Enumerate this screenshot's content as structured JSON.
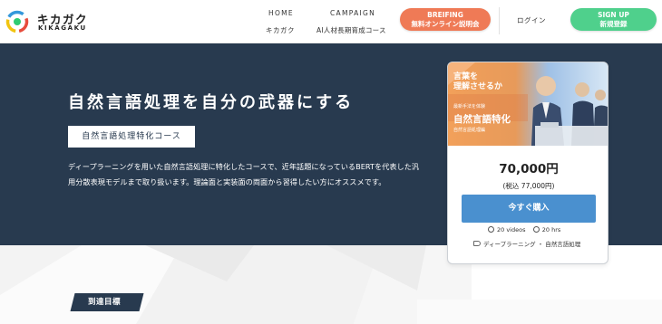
{
  "brand": {
    "name_jp": "キカガク",
    "name_en": "KIKAGAKU"
  },
  "nav": {
    "home": "HOME",
    "campaign": "CAMPAIGN",
    "kikagaku": "キカガク",
    "ai_course": "AI人材長期育成コース",
    "briefing_title": "BREIFING",
    "briefing_sub": "無料オンライン説明会",
    "login": "ログイン",
    "signup_title": "SIGN UP",
    "signup_sub": "新規登録"
  },
  "hero": {
    "title": "自然言語処理を自分の武器にする",
    "course_label": "自然言語処理特化コース",
    "description": "ディープラーニングを用いた自然言語処理に特化したコースで、近年話題になっているBERTを代表した汎用分散表現モデルまで取り扱います。理論面と実装面の両面から習得したい方にオススメです。"
  },
  "course_card": {
    "thumbnail_line1": "言葉を",
    "thumbnail_line2": "理解させるか",
    "thumbnail_line3": "最新手法を体験",
    "thumbnail_line4": "自然言語特化",
    "thumbnail_line5": "自然言語処理編",
    "price": "70,000円",
    "tax_included": "(税込 77,000円)",
    "buy_label": "今すぐ購入",
    "videos": "20 videos",
    "hours": "20 hrs",
    "tags": "ディープラーニング ・ 自然言語処理"
  },
  "section": {
    "goal_title": "到達目標"
  },
  "colors": {
    "navy": "#283a4f",
    "orange": "#ef7a56",
    "green": "#4fd08c",
    "blue": "#4a90cf"
  }
}
